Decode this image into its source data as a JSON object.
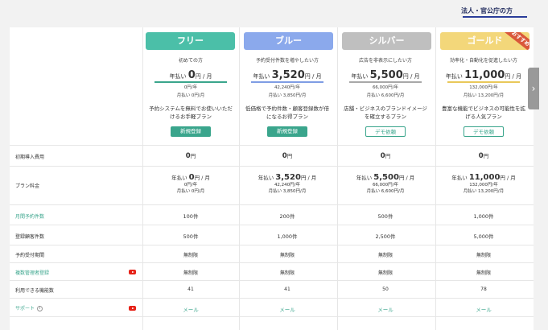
{
  "corporate_link": "法人・官公庁の方",
  "colors": {
    "free": "#4bbfa8",
    "blue": "#8ba9ec",
    "silver": "#bfbfbf",
    "gold": "#f3d77a",
    "accent": "#3aa58c",
    "line_free": "#3aa58c",
    "line_blue": "#7f9de4",
    "line_silver": "#a8a8a8",
    "line_gold": "#e9c85a"
  },
  "plans": [
    {
      "name": "フリー",
      "subtitle": "初めての方",
      "price_prefix": "年払い",
      "price": "0",
      "price_unit": "円 / 月",
      "yearly": "0円/年",
      "monthly": "月払い 0円/月",
      "desc": "予約システムを無料でお使いいただけるお手軽プラン",
      "button": "新規登録"
    },
    {
      "name": "ブルー",
      "subtitle": "予約受付件数を増やしたい方",
      "price_prefix": "年払い",
      "price": "3,520",
      "price_unit": "円 / 月",
      "yearly": "42,240円/年",
      "monthly": "月払い 3,850円/月",
      "desc": "低価格で予約件数・顧客登録数が倍になるお得プラン",
      "button": "新規登録"
    },
    {
      "name": "シルバー",
      "subtitle": "広告を非表示にしたい方",
      "price_prefix": "年払い",
      "price": "5,500",
      "price_unit": "円 / 月",
      "yearly": "66,000円/年",
      "monthly": "月払い 6,600円/月",
      "desc": "店舗・ビジネスのブランドイメージを確立するプラン",
      "button": "デモ依頼"
    },
    {
      "name": "ゴールド",
      "ribbon": "おすすめ",
      "subtitle": "効率化・自動化を促進したい方",
      "price_prefix": "年払い",
      "price": "11,000",
      "price_unit": "円 / 月",
      "yearly": "132,000円/年",
      "monthly": "月払い 13,200円/月",
      "desc": "豊富な機能でビジネスの可能性を拡げる人気プラン",
      "button": "デモ依頼"
    }
  ],
  "rows": {
    "initial_fee": {
      "label": "初期導入費用",
      "values": [
        "0",
        "0",
        "0",
        "0"
      ],
      "unit": "円"
    },
    "plan_fee": {
      "label": "プラン料金"
    },
    "monthly_bookings": {
      "label": "月間予約件数",
      "values": [
        "100件",
        "200件",
        "500件",
        "1,000件"
      ]
    },
    "registered_customers": {
      "label": "登録顧客件数",
      "values": [
        "500件",
        "1,000件",
        "2,500件",
        "5,000件"
      ]
    },
    "booking_period": {
      "label": "予約受付期間",
      "values": [
        "無制限",
        "無制限",
        "無制限",
        "無制限"
      ]
    },
    "multi_admin": {
      "label": "複数管理者登録",
      "values": [
        "無制限",
        "無制限",
        "無制限",
        "無制限"
      ]
    },
    "features": {
      "label": "利用できる機能数",
      "values": [
        "41",
        "41",
        "50",
        "78"
      ]
    },
    "support": {
      "label": "サポート",
      "info": "i",
      "values": [
        "メール",
        "メール",
        "メール",
        "メール"
      ]
    }
  },
  "side_arrow": "›"
}
